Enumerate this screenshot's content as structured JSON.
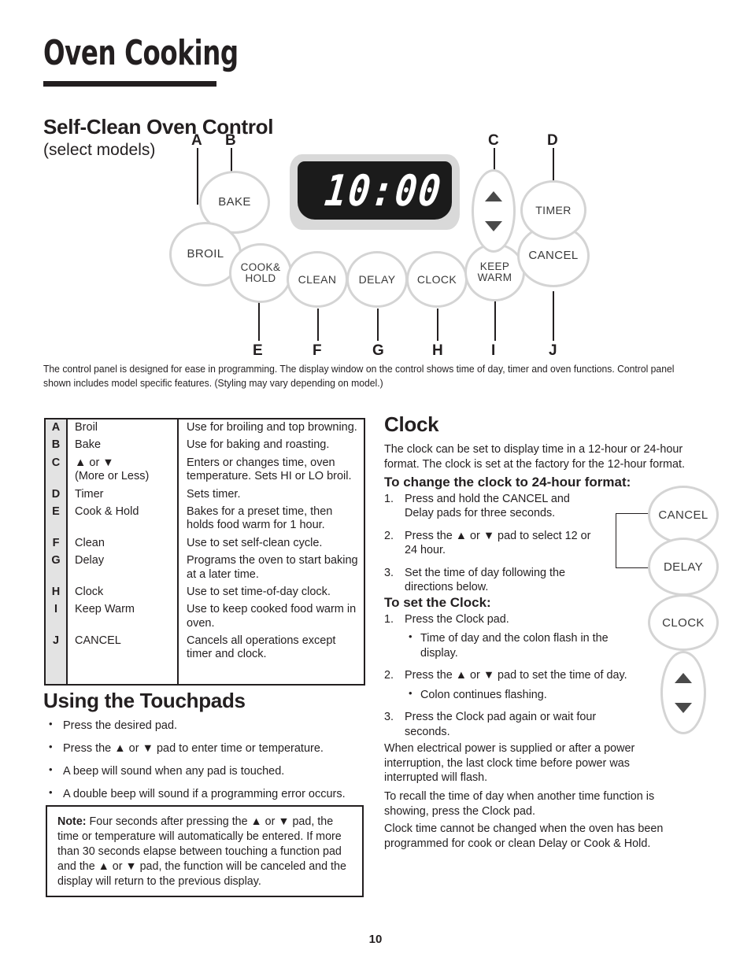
{
  "page": {
    "title": "Oven Cooking",
    "number": "10"
  },
  "self_clean": {
    "heading": "Self-Clean Oven Control",
    "subheading": "(select models)",
    "intro": "The control panel is designed for ease in programming. The display window on the control shows time of day, timer and oven functions. Control panel shown includes model specific features. (Styling may vary depending on model.)"
  },
  "control_panel": {
    "display_value": "10:00",
    "pads": [
      {
        "id": "bake",
        "label": "BAKE"
      },
      {
        "id": "broil",
        "label": "BROIL"
      },
      {
        "id": "cook-hold",
        "label": "COOK&\nHOLD"
      },
      {
        "id": "clean",
        "label": "CLEAN"
      },
      {
        "id": "delay",
        "label": "DELAY"
      },
      {
        "id": "clock",
        "label": "CLOCK"
      },
      {
        "id": "keep-warm",
        "label": "KEEP\nWARM"
      },
      {
        "id": "cancel",
        "label": "CANCEL"
      },
      {
        "id": "timer",
        "label": "TIMER"
      }
    ],
    "markers": [
      "A",
      "B",
      "C",
      "D",
      "E",
      "F",
      "G",
      "H",
      "I",
      "J"
    ]
  },
  "legend": {
    "rows": [
      {
        "key": "A",
        "fn": "Broil",
        "fn2": "",
        "desc": "Use for broiling and top browning."
      },
      {
        "key": "B",
        "fn": "Bake",
        "fn2": "",
        "desc": "Use for baking and roasting."
      },
      {
        "key": "C",
        "fn": "▲ or ▼",
        "fn2": "(More or Less)",
        "desc": "Enters or changes time, oven temperature.  Sets HI or LO broil."
      },
      {
        "key": "D",
        "fn": "Timer",
        "fn2": "",
        "desc": "Sets timer."
      },
      {
        "key": "E",
        "fn": "Cook & Hold",
        "fn2": "",
        "desc": "Bakes for a preset time, then holds food warm for 1 hour."
      },
      {
        "key": "F",
        "fn": "Clean",
        "fn2": "",
        "desc": "Use to set self-clean cycle."
      },
      {
        "key": "G",
        "fn": "Delay",
        "fn2": "",
        "desc": "Programs the oven to start baking at a later time."
      },
      {
        "key": "H",
        "fn": "Clock",
        "fn2": "",
        "desc": "Use to set time-of-day clock."
      },
      {
        "key": "I",
        "fn": "Keep Warm",
        "fn2": "",
        "desc": "Use to keep cooked food warm in oven."
      },
      {
        "key": "J",
        "fn": "CANCEL",
        "fn2": "",
        "desc": "Cancels all operations except timer and clock."
      }
    ]
  },
  "touchpads": {
    "heading": "Using the Touchpads",
    "bullets": [
      "Press the desired pad.",
      "Press the ▲ or ▼ pad to enter time or temperature.",
      "A beep will sound when any pad is touched.",
      "A double beep will sound if a programming error occurs."
    ]
  },
  "note": {
    "label": "Note:",
    "text": "Four seconds after pressing the ▲ or ▼ pad, the time or temperature will automatically be entered.  If more than 30 seconds elapse between touching a function pad and the ▲ or ▼ pad, the function will be canceled and the display will return to the previous display."
  },
  "clock": {
    "heading": "Clock",
    "intro": "The clock can be set to display time in a 12-hour or 24-hour format.  The clock is set at the factory for the 12-hour format.",
    "change_heading": "To change the clock to 24-hour format:",
    "change_steps": [
      {
        "num": "1.",
        "text": "Press and hold the CANCEL and Delay pads for three seconds."
      },
      {
        "num": "2.",
        "text": "Press the ▲ or ▼ pad to select 12 or 24 hour."
      },
      {
        "num": "3.",
        "text": "Set the time of day following the directions below."
      }
    ],
    "set_heading": "To set the Clock:",
    "set_steps": [
      {
        "num": "1.",
        "text": "Press the Clock pad.",
        "sub": [
          "Time of day and the colon flash in the display."
        ]
      },
      {
        "num": "2.",
        "text": "Press the ▲ or ▼ pad to set the time of day.",
        "sub": [
          "Colon continues flashing."
        ]
      },
      {
        "num": "3.",
        "text": "Press the Clock pad again or wait four seconds.",
        "sub": []
      }
    ],
    "paragraphs": [
      "When electrical power is supplied or after a power interruption, the last clock time before power was interrupted will flash.",
      "To recall the time of day when another time function is showing, press the Clock pad.",
      "Clock time cannot be changed when the oven has been programmed for cook or clean Delay or Cook & Hold."
    ],
    "side_pads": [
      {
        "id": "cancel",
        "label": "CANCEL"
      },
      {
        "id": "delay",
        "label": "DELAY"
      },
      {
        "id": "clock",
        "label": "CLOCK"
      }
    ]
  },
  "colors": {
    "ink": "#231f20",
    "pad_ring": "#d4d4d4",
    "table_key_bg": "#e3e3e3",
    "display_bg": "#1b1b1b"
  }
}
